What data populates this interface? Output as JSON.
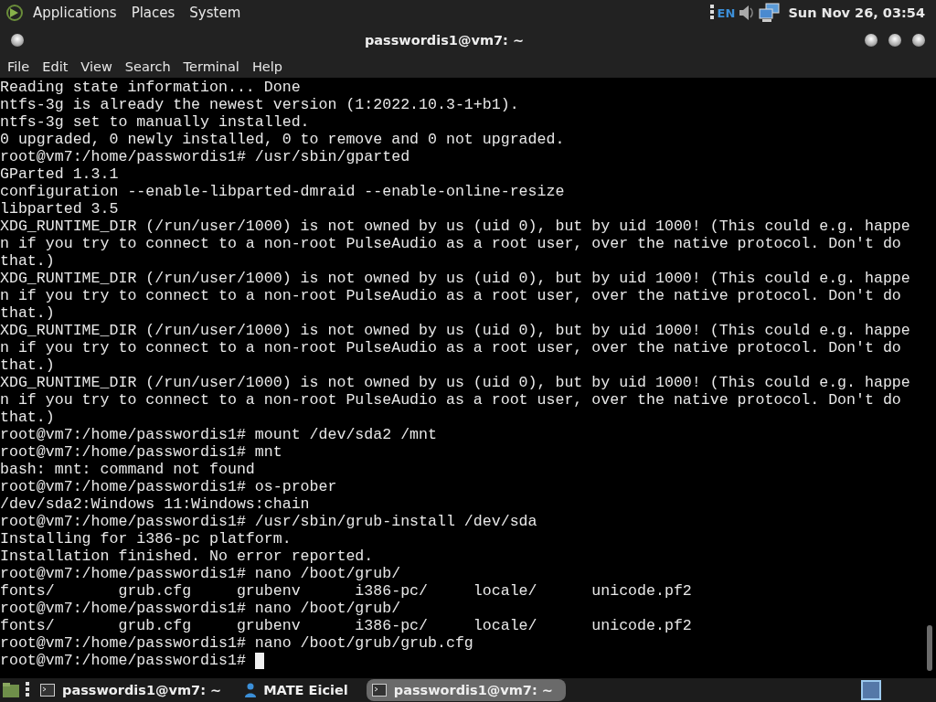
{
  "top_panel": {
    "menus": [
      "Applications",
      "Places",
      "System"
    ],
    "keyboard_layout": "EN",
    "clock": "Sun Nov 26, 03:54"
  },
  "window": {
    "title": "passwordis1@vm7: ~"
  },
  "menu_bar": [
    "File",
    "Edit",
    "View",
    "Search",
    "Terminal",
    "Help"
  ],
  "terminal": {
    "lines": [
      "Reading state information... Done",
      "ntfs-3g is already the newest version (1:2022.10.3-1+b1).",
      "ntfs-3g set to manually installed.",
      "0 upgraded, 0 newly installed, 0 to remove and 0 not upgraded.",
      "root@vm7:/home/passwordis1# /usr/sbin/gparted",
      "GParted 1.3.1",
      "configuration --enable-libparted-dmraid --enable-online-resize",
      "libparted 3.5",
      "XDG_RUNTIME_DIR (/run/user/1000) is not owned by us (uid 0), but by uid 1000! (This could e.g. happe",
      "n if you try to connect to a non-root PulseAudio as a root user, over the native protocol. Don't do",
      "that.)",
      "XDG_RUNTIME_DIR (/run/user/1000) is not owned by us (uid 0), but by uid 1000! (This could e.g. happe",
      "n if you try to connect to a non-root PulseAudio as a root user, over the native protocol. Don't do",
      "that.)",
      "XDG_RUNTIME_DIR (/run/user/1000) is not owned by us (uid 0), but by uid 1000! (This could e.g. happe",
      "n if you try to connect to a non-root PulseAudio as a root user, over the native protocol. Don't do",
      "that.)",
      "XDG_RUNTIME_DIR (/run/user/1000) is not owned by us (uid 0), but by uid 1000! (This could e.g. happe",
      "n if you try to connect to a non-root PulseAudio as a root user, over the native protocol. Don't do",
      "that.)",
      "root@vm7:/home/passwordis1# mount /dev/sda2 /mnt",
      "root@vm7:/home/passwordis1# mnt",
      "bash: mnt: command not found",
      "root@vm7:/home/passwordis1# os-prober",
      "/dev/sda2:Windows 11:Windows:chain",
      "root@vm7:/home/passwordis1# /usr/sbin/grub-install /dev/sda",
      "Installing for i386-pc platform.",
      "Installation finished. No error reported.",
      "root@vm7:/home/passwordis1# nano /boot/grub/",
      "fonts/       grub.cfg     grubenv      i386-pc/     locale/      unicode.pf2",
      "root@vm7:/home/passwordis1# nano /boot/grub/",
      "fonts/       grub.cfg     grubenv      i386-pc/     locale/      unicode.pf2",
      "root@vm7:/home/passwordis1# nano /boot/grub/grub.cfg"
    ],
    "prompt": "root@vm7:/home/passwordis1#"
  },
  "taskbar": {
    "tasks": [
      {
        "label": "passwordis1@vm7: ~",
        "kind": "terminal",
        "selected": false
      },
      {
        "label": "MATE Eiciel",
        "kind": "eiciel",
        "selected": false
      },
      {
        "label": "passwordis1@vm7: ~",
        "kind": "terminal",
        "selected": true
      }
    ]
  }
}
